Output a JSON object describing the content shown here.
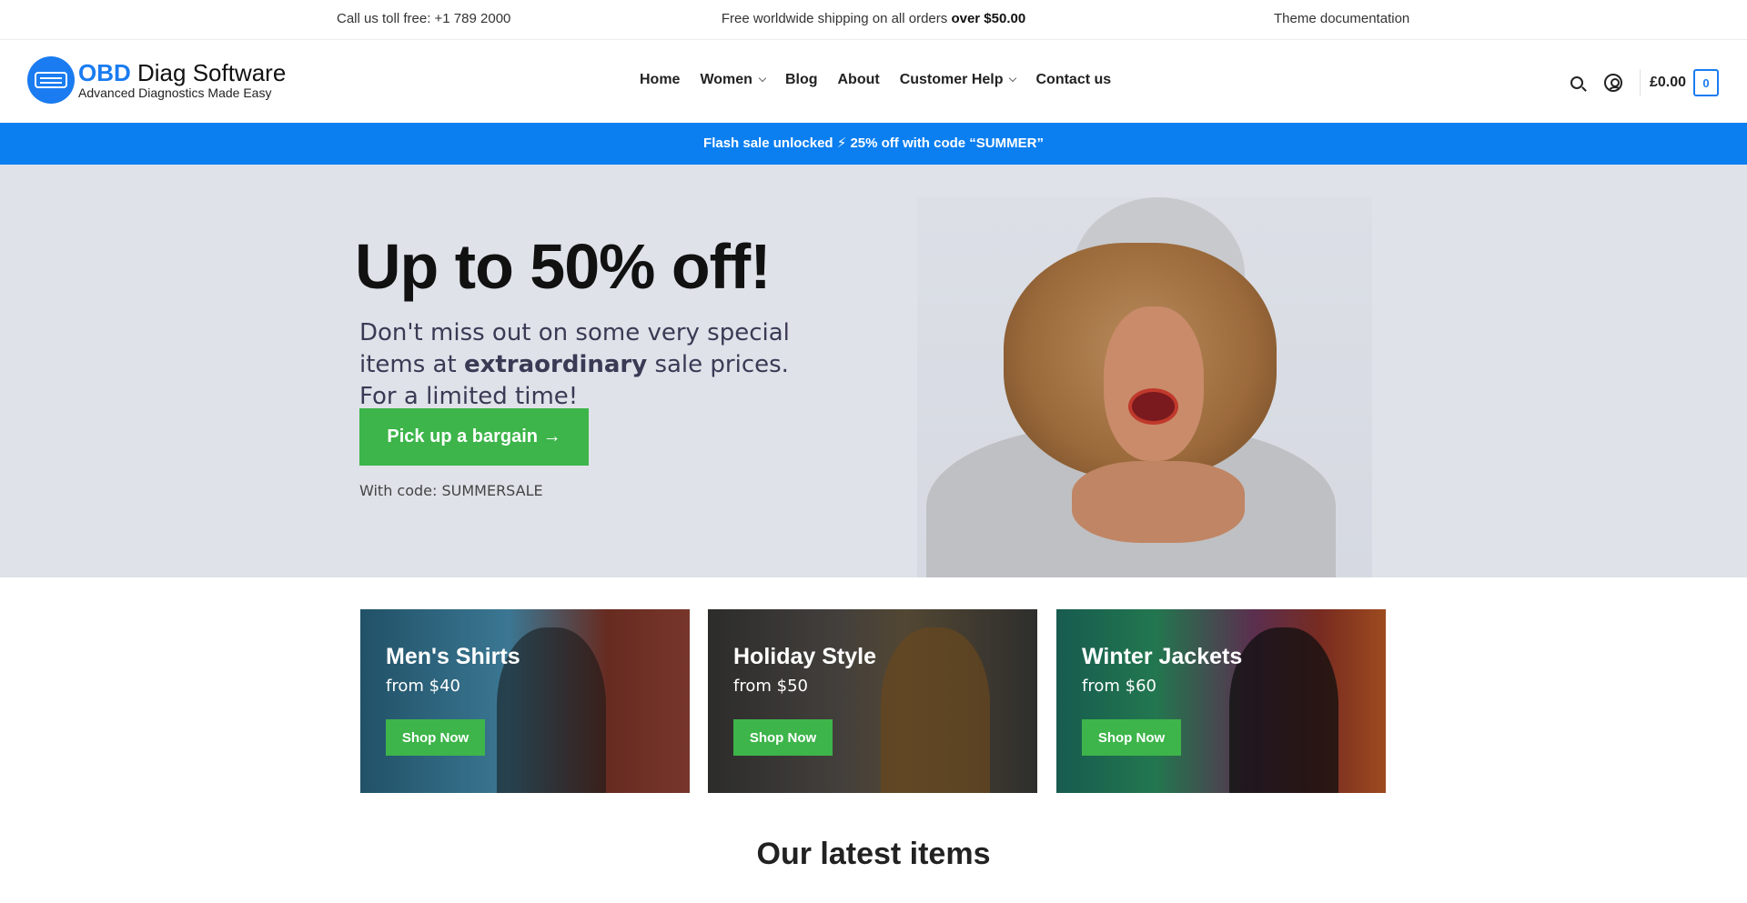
{
  "topbar": {
    "phone_text": "Call us toll free: +1 789 2000",
    "shipping_text": "Free worldwide shipping on all orders ",
    "shipping_bold": "over $50.00",
    "docs_link": "Theme documentation"
  },
  "header": {
    "logo": {
      "brand": "OBD",
      "title_rest": " Diag Software",
      "tagline": "Advanced Diagnostics Made Easy"
    },
    "nav": [
      {
        "label": "Home",
        "has_dropdown": false
      },
      {
        "label": "Women",
        "has_dropdown": true
      },
      {
        "label": "Blog",
        "has_dropdown": false
      },
      {
        "label": "About",
        "has_dropdown": false
      },
      {
        "label": "Customer Help",
        "has_dropdown": true
      },
      {
        "label": "Contact us",
        "has_dropdown": false
      }
    ],
    "cart_total": "£0.00",
    "cart_count": "0",
    "icons": [
      "search-icon",
      "user-account-icon"
    ]
  },
  "flash_banner": {
    "text": "Flash sale unlocked ⚡ 25% off with code “SUMMER”"
  },
  "hero": {
    "title": "Up to 50% off!",
    "text_before": "Don't miss out on some very special items at ",
    "text_bold": "extraordinary",
    "text_after": " sale prices. For a limited time!",
    "button_label": "Pick up a bargain →",
    "code_text": "With code: SUMMERSALE"
  },
  "categories": [
    {
      "title": "Men's Shirts",
      "price": "from $40",
      "button": "Shop Now"
    },
    {
      "title": "Holiday Style",
      "price": "from $50",
      "button": "Shop Now"
    },
    {
      "title": "Winter Jackets",
      "price": "from $60",
      "button": "Shop Now"
    }
  ],
  "latest": {
    "title": "Our latest items"
  },
  "colors": {
    "accent_blue": "#0b7ff0",
    "button_green": "#3db54a",
    "hero_bg": "#dfe2e9"
  }
}
